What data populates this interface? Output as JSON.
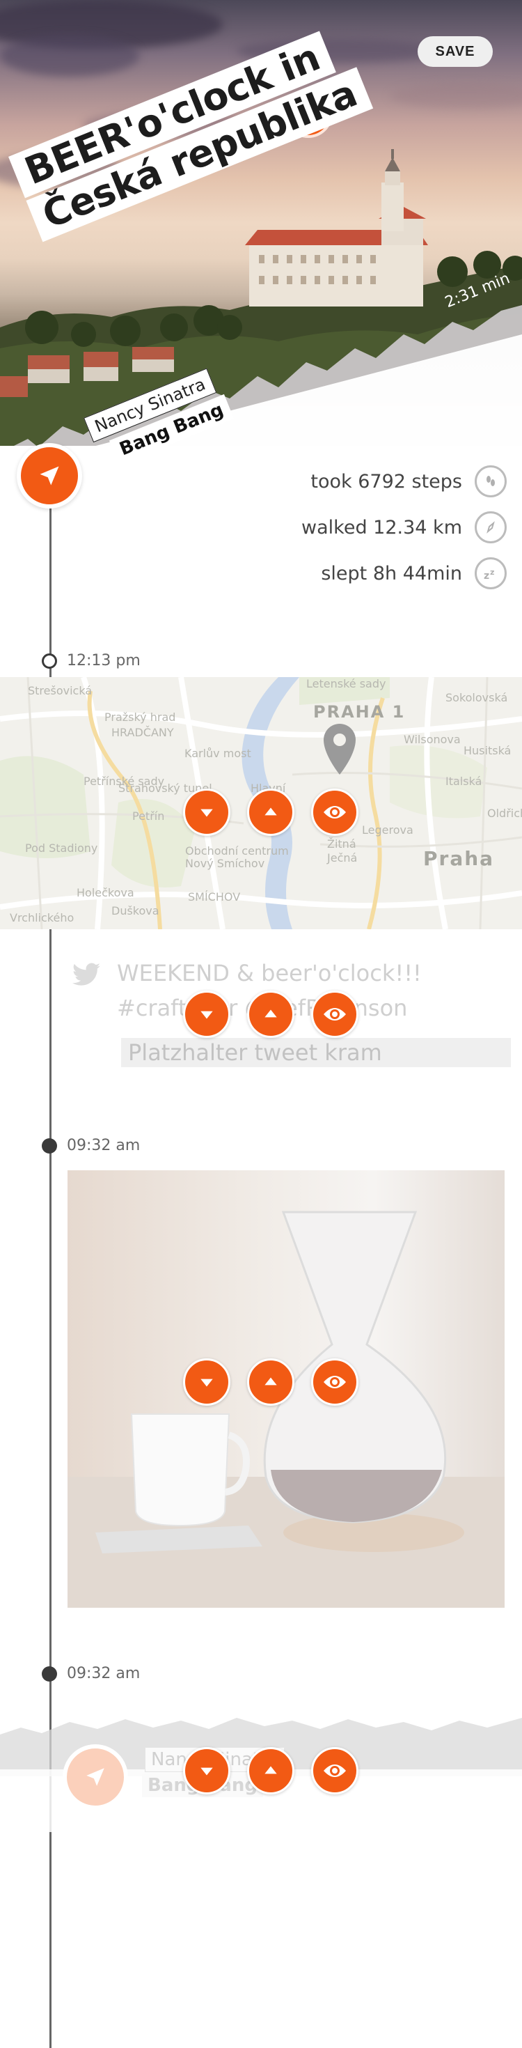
{
  "header": {
    "save_label": "SAVE",
    "title_lines": [
      "BEER'o'clock in",
      "Česká republika"
    ],
    "duration": "2:31 min"
  },
  "song": {
    "artist": "Nancy Sinatra",
    "title": "Bang Bang"
  },
  "stats": [
    {
      "text": "took 6792 steps",
      "icon": "footsteps-icon"
    },
    {
      "text": "walked 12.34 km",
      "icon": "compass-icon"
    },
    {
      "text": "slept 8h 44min",
      "icon": "sleep-icon"
    }
  ],
  "timeline": {
    "times": [
      "12:13 pm",
      "09:32 am",
      "09:32 am"
    ]
  },
  "map": {
    "labels": [
      "Strešovická",
      "Pražský hrad",
      "HRADČANY",
      "Karlův most",
      "PRAHA 1",
      "Letenské sady",
      "Sokolovská",
      "Wilsonova",
      "Petřínské sady",
      "Petřín",
      "Hlavní",
      "Obchodní centrum",
      "Nový Smíchov",
      "SMÍCHOV",
      "Praha",
      "Žitná",
      "Ječná",
      "Legerova",
      "Italská",
      "Husitská",
      "Oldřichova",
      "Vrchlického",
      "Holečkova",
      "Duškova",
      "Pod Stadiony",
      "Strahovský tunel"
    ]
  },
  "tweet": {
    "line1": "WEEKEND & beer'o'clock!!!",
    "line2": "#craftbeer @DefRobinson",
    "placeholder": "Platzhalter tweet kram"
  },
  "bottom_song": {
    "artist": "Nancy Sinatra",
    "title": "Bang Bang"
  },
  "icons": {
    "move_down": "chevron-down-icon",
    "move_up": "chevron-up-icon",
    "toggle": "eye-icon",
    "edit": "pencil-icon",
    "play": "location-arrow-icon"
  },
  "colors": {
    "accent": "#f25a14",
    "text": "#3a3a3a",
    "muted": "#666666"
  }
}
